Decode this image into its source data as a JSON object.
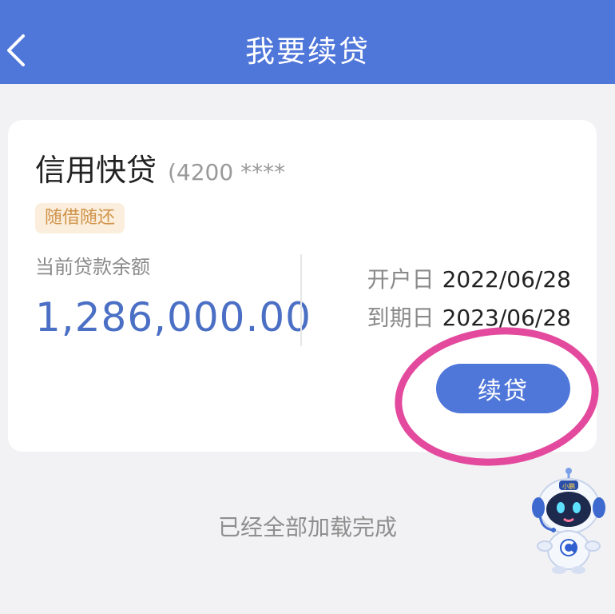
{
  "header": {
    "title": "我要续贷",
    "back_icon": "chevron-left-icon"
  },
  "card": {
    "product_name": "信用快贷",
    "account": "(4200 ****",
    "tag": "随借随还",
    "balance_label": "当前贷款余额",
    "balance_value": "1,286,000.00",
    "open_date_label": "开户日",
    "open_date": "2022/06/28",
    "due_date_label": "到期日",
    "due_date": "2023/06/28",
    "renew_button": "续贷"
  },
  "footer": {
    "loaded_text": "已经全部加载完成"
  },
  "mascot": {
    "icon": "robot-assistant-icon",
    "badge": "小鹏"
  },
  "colors": {
    "brand": "#4f76d9",
    "balance": "#4a6fc4",
    "tag_text": "#d0934a",
    "tag_bg": "#fbeedc",
    "highlight_circle": "#e34a9e"
  }
}
